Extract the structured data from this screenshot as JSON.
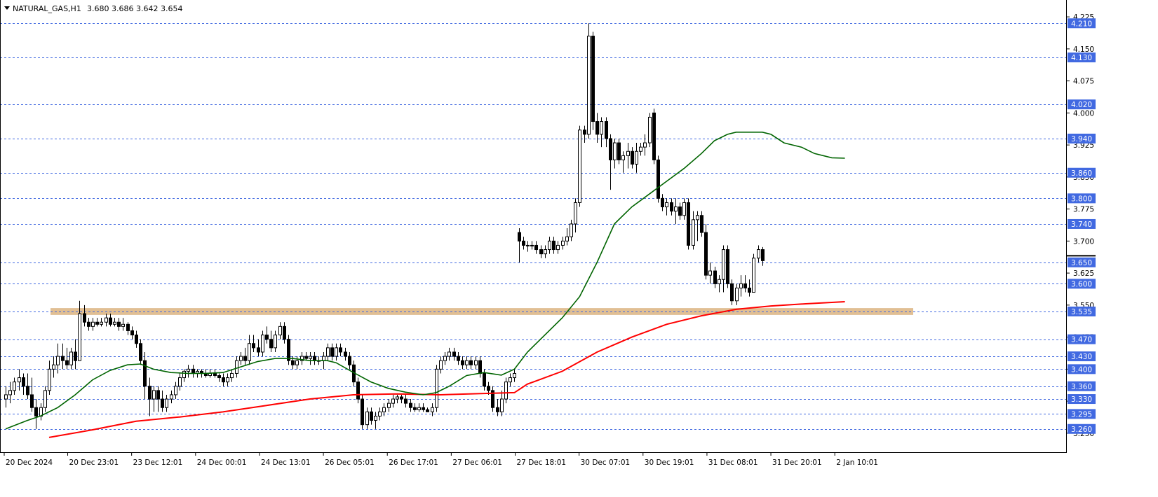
{
  "header": {
    "symbol": "NATURAL_GAS,H1",
    "ohlc": "3.680 3.686 3.642 3.654"
  },
  "chart_data": {
    "type": "candlestick",
    "ylim": [
      3.235,
      4.235
    ],
    "price_ticks": [
      "4.225",
      "4.150",
      "4.075",
      "4.000",
      "3.925",
      "3.850",
      "3.775",
      "3.700",
      "3.625",
      "3.550",
      "3.475",
      "3.400",
      "3.325",
      "3.250"
    ],
    "level_lines": [
      "4.210",
      "4.130",
      "4.020",
      "3.940",
      "3.860",
      "3.800",
      "3.740",
      "3.650",
      "3.600",
      "3.535",
      "3.470",
      "3.430",
      "3.400",
      "3.360",
      "3.330",
      "3.295",
      "3.260"
    ],
    "time_labels": [
      "20 Dec 2024",
      "20 Dec 23:01",
      "23 Dec 12:01",
      "24 Dec 00:01",
      "24 Dec 13:01",
      "26 Dec 05:01",
      "26 Dec 17:01",
      "27 Dec 06:01",
      "27 Dec 18:01",
      "30 Dec 07:01",
      "30 Dec 19:01",
      "31 Dec 08:01",
      "31 Dec 20:01",
      "2 Jan 10:01"
    ],
    "zone": {
      "low": 3.527,
      "high": 3.543
    },
    "current_price": "3.654",
    "colors": {
      "bull": "#ffffff",
      "bear": "#000000",
      "ma_fast": "#006400",
      "ma_slow": "#ff0000",
      "zone": "#deb887",
      "level": "#4169e1",
      "badge": "#4169e1"
    },
    "candles": [
      [
        3.33,
        3.36,
        3.31,
        3.34
      ],
      [
        3.34,
        3.37,
        3.32,
        3.35
      ],
      [
        3.35,
        3.38,
        3.34,
        3.37
      ],
      [
        3.37,
        3.4,
        3.35,
        3.38
      ],
      [
        3.38,
        3.39,
        3.34,
        3.36
      ],
      [
        3.36,
        3.39,
        3.33,
        3.34
      ],
      [
        3.34,
        3.38,
        3.3,
        3.31
      ],
      [
        3.31,
        3.33,
        3.26,
        3.29
      ],
      [
        3.29,
        3.32,
        3.28,
        3.31
      ],
      [
        3.31,
        3.36,
        3.3,
        3.35
      ],
      [
        3.35,
        3.42,
        3.34,
        3.4
      ],
      [
        3.4,
        3.43,
        3.38,
        3.41
      ],
      [
        3.41,
        3.46,
        3.39,
        3.43
      ],
      [
        3.43,
        3.46,
        3.4,
        3.42
      ],
      [
        3.42,
        3.45,
        3.4,
        3.41
      ],
      [
        3.41,
        3.45,
        3.4,
        3.44
      ],
      [
        3.44,
        3.47,
        3.4,
        3.42
      ],
      [
        3.42,
        3.56,
        3.42,
        3.53
      ],
      [
        3.53,
        3.55,
        3.5,
        3.51
      ],
      [
        3.51,
        3.52,
        3.49,
        3.5
      ],
      [
        3.5,
        3.52,
        3.49,
        3.51
      ],
      [
        3.51,
        3.52,
        3.5,
        3.505
      ],
      [
        3.505,
        3.52,
        3.5,
        3.51
      ],
      [
        3.51,
        3.53,
        3.5,
        3.52
      ],
      [
        3.52,
        3.53,
        3.5,
        3.505
      ],
      [
        3.505,
        3.52,
        3.5,
        3.51
      ],
      [
        3.51,
        3.52,
        3.49,
        3.5
      ],
      [
        3.5,
        3.52,
        3.49,
        3.505
      ],
      [
        3.505,
        3.51,
        3.48,
        3.49
      ],
      [
        3.49,
        3.5,
        3.47,
        3.48
      ],
      [
        3.48,
        3.49,
        3.45,
        3.46
      ],
      [
        3.46,
        3.47,
        3.41,
        3.42
      ],
      [
        3.42,
        3.44,
        3.33,
        3.36
      ],
      [
        3.36,
        3.38,
        3.29,
        3.33
      ],
      [
        3.33,
        3.36,
        3.3,
        3.35
      ],
      [
        3.35,
        3.36,
        3.3,
        3.33
      ],
      [
        3.33,
        3.35,
        3.3,
        3.31
      ],
      [
        3.31,
        3.34,
        3.3,
        3.33
      ],
      [
        3.33,
        3.35,
        3.32,
        3.34
      ],
      [
        3.34,
        3.37,
        3.33,
        3.36
      ],
      [
        3.36,
        3.39,
        3.35,
        3.38
      ],
      [
        3.38,
        3.4,
        3.37,
        3.395
      ],
      [
        3.395,
        3.41,
        3.38,
        3.4
      ],
      [
        3.4,
        3.41,
        3.38,
        3.39
      ],
      [
        3.39,
        3.4,
        3.38,
        3.395
      ],
      [
        3.395,
        3.4,
        3.38,
        3.39
      ],
      [
        3.39,
        3.4,
        3.38,
        3.385
      ],
      [
        3.385,
        3.4,
        3.38,
        3.39
      ],
      [
        3.39,
        3.4,
        3.38,
        3.385
      ],
      [
        3.385,
        3.39,
        3.37,
        3.38
      ],
      [
        3.38,
        3.39,
        3.36,
        3.37
      ],
      [
        3.37,
        3.39,
        3.36,
        3.38
      ],
      [
        3.38,
        3.4,
        3.37,
        3.39
      ],
      [
        3.39,
        3.43,
        3.38,
        3.42
      ],
      [
        3.42,
        3.44,
        3.41,
        3.43
      ],
      [
        3.43,
        3.45,
        3.41,
        3.42
      ],
      [
        3.42,
        3.48,
        3.41,
        3.46
      ],
      [
        3.46,
        3.48,
        3.44,
        3.45
      ],
      [
        3.45,
        3.47,
        3.43,
        3.44
      ],
      [
        3.44,
        3.49,
        3.43,
        3.48
      ],
      [
        3.48,
        3.5,
        3.46,
        3.47
      ],
      [
        3.47,
        3.49,
        3.44,
        3.45
      ],
      [
        3.45,
        3.49,
        3.44,
        3.48
      ],
      [
        3.48,
        3.51,
        3.47,
        3.5
      ],
      [
        3.5,
        3.51,
        3.46,
        3.47
      ],
      [
        3.47,
        3.48,
        3.41,
        3.42
      ],
      [
        3.42,
        3.43,
        3.4,
        3.41
      ],
      [
        3.41,
        3.43,
        3.4,
        3.42
      ],
      [
        3.42,
        3.44,
        3.41,
        3.43
      ],
      [
        3.43,
        3.44,
        3.42,
        3.425
      ],
      [
        3.425,
        3.44,
        3.41,
        3.43
      ],
      [
        3.43,
        3.44,
        3.41,
        3.42
      ],
      [
        3.42,
        3.43,
        3.41,
        3.42
      ],
      [
        3.42,
        3.44,
        3.4,
        3.43
      ],
      [
        3.43,
        3.46,
        3.42,
        3.45
      ],
      [
        3.45,
        3.46,
        3.42,
        3.43
      ],
      [
        3.43,
        3.46,
        3.42,
        3.45
      ],
      [
        3.45,
        3.46,
        3.43,
        3.44
      ],
      [
        3.44,
        3.45,
        3.42,
        3.43
      ],
      [
        3.43,
        3.44,
        3.4,
        3.41
      ],
      [
        3.41,
        3.42,
        3.36,
        3.37
      ],
      [
        3.37,
        3.38,
        3.32,
        3.33
      ],
      [
        3.33,
        3.34,
        3.26,
        3.27
      ],
      [
        3.27,
        3.31,
        3.26,
        3.3
      ],
      [
        3.3,
        3.31,
        3.27,
        3.28
      ],
      [
        3.28,
        3.3,
        3.26,
        3.29
      ],
      [
        3.29,
        3.31,
        3.28,
        3.3
      ],
      [
        3.3,
        3.32,
        3.29,
        3.31
      ],
      [
        3.31,
        3.33,
        3.3,
        3.32
      ],
      [
        3.32,
        3.34,
        3.31,
        3.33
      ],
      [
        3.33,
        3.34,
        3.32,
        3.335
      ],
      [
        3.335,
        3.34,
        3.32,
        3.33
      ],
      [
        3.33,
        3.34,
        3.31,
        3.32
      ],
      [
        3.32,
        3.33,
        3.3,
        3.31
      ],
      [
        3.31,
        3.32,
        3.3,
        3.305
      ],
      [
        3.305,
        3.32,
        3.3,
        3.31
      ],
      [
        3.31,
        3.32,
        3.3,
        3.305
      ],
      [
        3.305,
        3.31,
        3.3,
        3.3
      ],
      [
        3.3,
        3.32,
        3.29,
        3.31
      ],
      [
        3.31,
        3.41,
        3.3,
        3.4
      ],
      [
        3.4,
        3.43,
        3.39,
        3.42
      ],
      [
        3.42,
        3.44,
        3.41,
        3.43
      ],
      [
        3.43,
        3.45,
        3.42,
        3.44
      ],
      [
        3.44,
        3.45,
        3.42,
        3.43
      ],
      [
        3.43,
        3.44,
        3.41,
        3.42
      ],
      [
        3.42,
        3.43,
        3.4,
        3.41
      ],
      [
        3.41,
        3.43,
        3.4,
        3.42
      ],
      [
        3.42,
        3.43,
        3.4,
        3.41
      ],
      [
        3.41,
        3.43,
        3.4,
        3.42
      ],
      [
        3.42,
        3.43,
        3.38,
        3.39
      ],
      [
        3.39,
        3.4,
        3.35,
        3.36
      ],
      [
        3.36,
        3.37,
        3.34,
        3.35
      ],
      [
        3.35,
        3.36,
        3.3,
        3.31
      ],
      [
        3.31,
        3.33,
        3.29,
        3.3
      ],
      [
        3.3,
        3.35,
        3.29,
        3.33
      ],
      [
        3.33,
        3.38,
        3.32,
        3.37
      ],
      [
        3.37,
        3.39,
        3.36,
        3.38
      ],
      [
        3.38,
        3.4,
        3.37,
        3.39
      ],
      [
        3.72,
        3.73,
        3.65,
        3.7
      ],
      [
        3.7,
        3.71,
        3.68,
        3.69
      ],
      [
        3.69,
        3.7,
        3.675,
        3.69
      ],
      [
        3.69,
        3.7,
        3.68,
        3.69
      ],
      [
        3.69,
        3.7,
        3.67,
        3.68
      ],
      [
        3.68,
        3.69,
        3.66,
        3.67
      ],
      [
        3.67,
        3.69,
        3.66,
        3.68
      ],
      [
        3.68,
        3.71,
        3.67,
        3.7
      ],
      [
        3.7,
        3.71,
        3.67,
        3.68
      ],
      [
        3.68,
        3.7,
        3.67,
        3.69
      ],
      [
        3.69,
        3.71,
        3.68,
        3.7
      ],
      [
        3.7,
        3.73,
        3.69,
        3.71
      ],
      [
        3.71,
        3.75,
        3.7,
        3.74
      ],
      [
        3.74,
        3.8,
        3.72,
        3.79
      ],
      [
        3.79,
        3.97,
        3.78,
        3.96
      ],
      [
        3.96,
        3.97,
        3.93,
        3.95
      ],
      [
        3.95,
        4.21,
        3.94,
        4.18
      ],
      [
        4.18,
        4.19,
        3.96,
        3.98
      ],
      [
        3.98,
        4.0,
        3.93,
        3.95
      ],
      [
        3.95,
        3.99,
        3.92,
        3.98
      ],
      [
        3.98,
        3.99,
        3.92,
        3.94
      ],
      [
        3.94,
        3.95,
        3.82,
        3.89
      ],
      [
        3.89,
        3.94,
        3.87,
        3.93
      ],
      [
        3.93,
        3.94,
        3.88,
        3.89
      ],
      [
        3.89,
        3.91,
        3.86,
        3.9
      ],
      [
        3.9,
        3.93,
        3.87,
        3.91
      ],
      [
        3.91,
        3.92,
        3.87,
        3.88
      ],
      [
        3.88,
        3.93,
        3.86,
        3.91
      ],
      [
        3.91,
        3.93,
        3.9,
        3.92
      ],
      [
        3.92,
        3.95,
        3.9,
        3.93
      ],
      [
        3.93,
        4.0,
        3.92,
        3.99
      ],
      [
        4.0,
        4.01,
        3.88,
        3.89
      ],
      [
        3.89,
        3.9,
        3.79,
        3.8
      ],
      [
        3.8,
        3.81,
        3.77,
        3.78
      ],
      [
        3.78,
        3.8,
        3.76,
        3.79
      ],
      [
        3.79,
        3.8,
        3.76,
        3.77
      ],
      [
        3.77,
        3.8,
        3.74,
        3.78
      ],
      [
        3.78,
        3.79,
        3.75,
        3.76
      ],
      [
        3.76,
        3.8,
        3.75,
        3.79
      ],
      [
        3.79,
        3.8,
        3.68,
        3.69
      ],
      [
        3.69,
        3.77,
        3.68,
        3.75
      ],
      [
        3.75,
        3.77,
        3.7,
        3.76
      ],
      [
        3.76,
        3.77,
        3.71,
        3.72
      ],
      [
        3.72,
        3.74,
        3.61,
        3.62
      ],
      [
        3.62,
        3.65,
        3.6,
        3.63
      ],
      [
        3.63,
        3.64,
        3.59,
        3.6
      ],
      [
        3.6,
        3.62,
        3.58,
        3.61
      ],
      [
        3.61,
        3.69,
        3.58,
        3.68
      ],
      [
        3.68,
        3.69,
        3.59,
        3.6
      ],
      [
        3.6,
        3.61,
        3.55,
        3.56
      ],
      [
        3.56,
        3.6,
        3.55,
        3.59
      ],
      [
        3.59,
        3.62,
        3.57,
        3.6
      ],
      [
        3.6,
        3.62,
        3.58,
        3.59
      ],
      [
        3.59,
        3.61,
        3.57,
        3.58
      ],
      [
        3.58,
        3.67,
        3.58,
        3.66
      ],
      [
        3.66,
        3.69,
        3.65,
        3.68
      ],
      [
        3.68,
        3.686,
        3.642,
        3.654
      ]
    ],
    "ma_fast": [
      [
        0,
        3.26
      ],
      [
        2,
        3.268
      ],
      [
        5,
        3.28
      ],
      [
        8,
        3.29
      ],
      [
        12,
        3.31
      ],
      [
        16,
        3.34
      ],
      [
        20,
        3.375
      ],
      [
        24,
        3.397
      ],
      [
        28,
        3.41
      ],
      [
        31,
        3.412
      ],
      [
        34,
        3.4
      ],
      [
        38,
        3.392
      ],
      [
        42,
        3.39
      ],
      [
        46,
        3.39
      ],
      [
        50,
        3.392
      ],
      [
        54,
        3.405
      ],
      [
        58,
        3.418
      ],
      [
        62,
        3.425
      ],
      [
        66,
        3.425
      ],
      [
        70,
        3.42
      ],
      [
        74,
        3.42
      ],
      [
        76,
        3.415
      ],
      [
        80,
        3.392
      ],
      [
        84,
        3.37
      ],
      [
        88,
        3.355
      ],
      [
        92,
        3.346
      ],
      [
        96,
        3.34
      ],
      [
        99,
        3.345
      ],
      [
        102,
        3.36
      ],
      [
        106,
        3.385
      ],
      [
        110,
        3.392
      ],
      [
        114,
        3.386
      ],
      [
        117,
        3.4
      ],
      [
        120,
        3.44
      ],
      [
        124,
        3.48
      ],
      [
        128,
        3.52
      ],
      [
        132,
        3.57
      ],
      [
        136,
        3.65
      ],
      [
        140,
        3.74
      ],
      [
        144,
        3.78
      ],
      [
        148,
        3.81
      ],
      [
        152,
        3.84
      ],
      [
        156,
        3.87
      ],
      [
        160,
        3.905
      ],
      [
        163,
        3.935
      ],
      [
        166,
        3.95
      ],
      [
        168,
        3.955
      ],
      [
        171,
        3.955
      ],
      [
        174,
        3.955
      ],
      [
        176,
        3.95
      ],
      [
        179,
        3.93
      ],
      [
        183,
        3.92
      ],
      [
        186,
        3.905
      ],
      [
        190,
        3.895
      ],
      [
        193,
        3.894
      ]
    ],
    "ma_slow": [
      [
        10,
        3.24
      ],
      [
        20,
        3.258
      ],
      [
        30,
        3.278
      ],
      [
        40,
        3.288
      ],
      [
        50,
        3.3
      ],
      [
        60,
        3.315
      ],
      [
        70,
        3.33
      ],
      [
        80,
        3.34
      ],
      [
        90,
        3.342
      ],
      [
        100,
        3.34
      ],
      [
        110,
        3.343
      ],
      [
        117,
        3.345
      ],
      [
        120,
        3.365
      ],
      [
        128,
        3.395
      ],
      [
        136,
        3.44
      ],
      [
        144,
        3.475
      ],
      [
        152,
        3.505
      ],
      [
        160,
        3.525
      ],
      [
        168,
        3.54
      ],
      [
        176,
        3.548
      ],
      [
        184,
        3.553
      ],
      [
        193,
        3.558
      ]
    ]
  }
}
